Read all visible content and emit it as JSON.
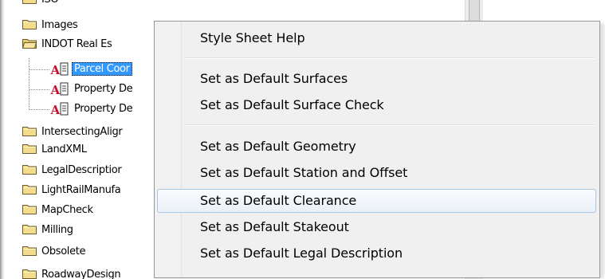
{
  "tree": {
    "items": [
      {
        "label": "ISO",
        "icon": "folder-icon",
        "level": 0
      },
      {
        "label": "Images",
        "icon": "folder-icon",
        "level": 0
      },
      {
        "label": "INDOT Real Es",
        "icon": "folder-open-icon",
        "level": 0
      },
      {
        "label": "Parcel Coor",
        "icon": "stylesheet-doc-icon",
        "level": 1,
        "selected": true
      },
      {
        "label": "Property De",
        "icon": "stylesheet-doc-icon",
        "level": 1
      },
      {
        "label": "Property De",
        "icon": "stylesheet-doc-icon",
        "level": 1
      },
      {
        "label": "IntersectingAligr",
        "icon": "folder-icon",
        "level": 0
      },
      {
        "label": "LandXML",
        "icon": "folder-icon",
        "level": 0
      },
      {
        "label": "LegalDescriptior",
        "icon": "folder-icon",
        "level": 0
      },
      {
        "label": "LightRailManufa",
        "icon": "folder-icon",
        "level": 0
      },
      {
        "label": "MapCheck",
        "icon": "folder-icon",
        "level": 0
      },
      {
        "label": "Milling",
        "icon": "folder-icon",
        "level": 0
      },
      {
        "label": "Obsolete",
        "icon": "folder-icon",
        "level": 0
      },
      {
        "label": "RoadwayDesign",
        "icon": "folder-icon",
        "level": 0
      }
    ]
  },
  "context_menu": {
    "items": [
      {
        "label": "Style Sheet Help"
      },
      {
        "label": "Set as Default Surfaces"
      },
      {
        "label": "Set as Default Surface Check"
      },
      {
        "label": "Set as Default Geometry"
      },
      {
        "label": "Set as Default Station and Offset"
      },
      {
        "label": "Set as Default Clearance",
        "hovered": true
      },
      {
        "label": "Set as Default Stakeout"
      },
      {
        "label": "Set as Default Legal Description"
      }
    ]
  },
  "colors": {
    "selection": "#3399ff",
    "menu_background": "#f0f0f0",
    "menu_border": "#979797",
    "hover_border": "#a8c8ea",
    "folder_yellow": "#f3dc8c",
    "doc_icon_red": "#c8102e"
  }
}
